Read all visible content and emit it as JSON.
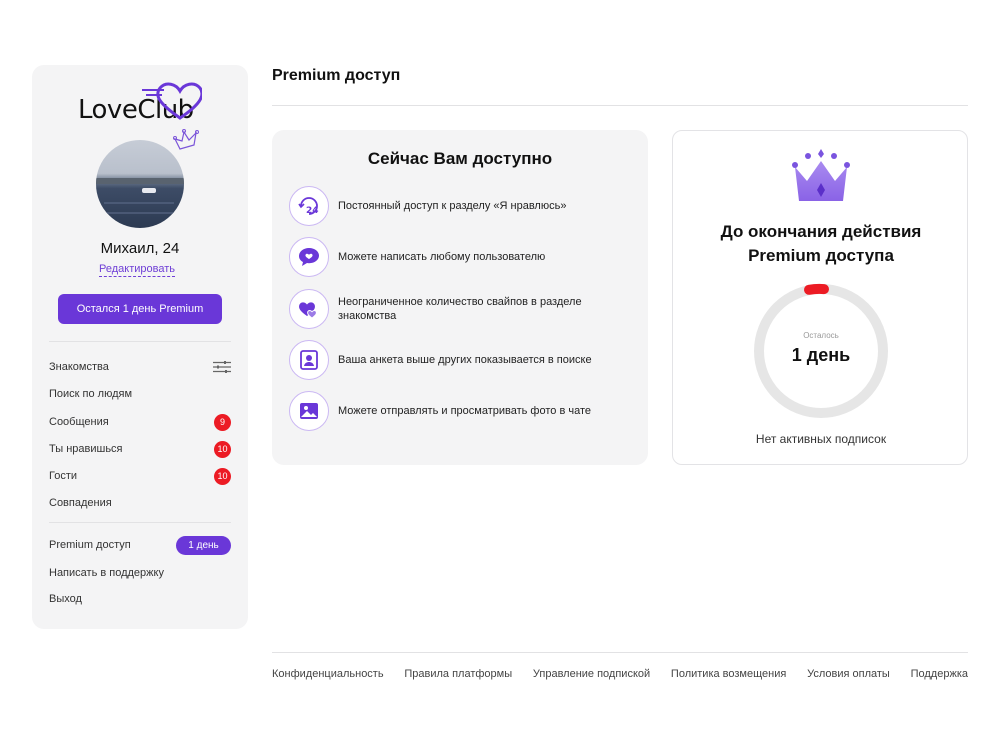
{
  "colors": {
    "accent": "#6a37d8",
    "badge": "#ec1b24",
    "panel": "#f4f4f5",
    "ring_track": "#e6e6e6",
    "ring_progress": "#ec1b24"
  },
  "sidebar": {
    "logo_text": "LoveClub",
    "user_name": "Михаил, 24",
    "edit_label": "Редактировать",
    "premium_button": "Остался 1 день Premium",
    "menu": [
      {
        "label": "Знакомства",
        "icon": "filter-icon"
      },
      {
        "label": "Поиск по людям"
      },
      {
        "label": "Сообщения",
        "badge": "9"
      },
      {
        "label": "Ты нравишься",
        "badge": "10"
      },
      {
        "label": "Гости",
        "badge": "10"
      },
      {
        "label": "Совпадения"
      }
    ],
    "bottom_menu": [
      {
        "label": "Premium доступ",
        "pill": "1 день"
      },
      {
        "label": "Написать в поддержку"
      },
      {
        "label": "Выход"
      }
    ]
  },
  "header": {
    "title": "Premium доступ"
  },
  "features": {
    "title": "Сейчас Вам доступно",
    "items": [
      {
        "icon": "clock-24-icon",
        "text": "Постоянный доступ к разделу «Я нравлюсь»"
      },
      {
        "icon": "chat-heart-icon",
        "text": "Можете написать любому пользователю"
      },
      {
        "icon": "hearts-icon",
        "text": "Неограниченное количество свайпов в разделе знакомства"
      },
      {
        "icon": "profile-card-icon",
        "text": "Ваша анкета выше других показывается в поиске"
      },
      {
        "icon": "image-icon",
        "text": "Можете отправлять и просматривать фото в чате"
      }
    ]
  },
  "status": {
    "title_line1": "До окончания действия",
    "title_line2": "Premium доступа",
    "remaining_label": "Осталось",
    "remaining_value": "1 день",
    "no_subscriptions": "Нет активных подписок"
  },
  "footer": {
    "links": [
      "Конфиденциальность",
      "Правила платформы",
      "Управление подпиской",
      "Политика возмещения",
      "Условия оплаты",
      "Поддержка"
    ]
  }
}
